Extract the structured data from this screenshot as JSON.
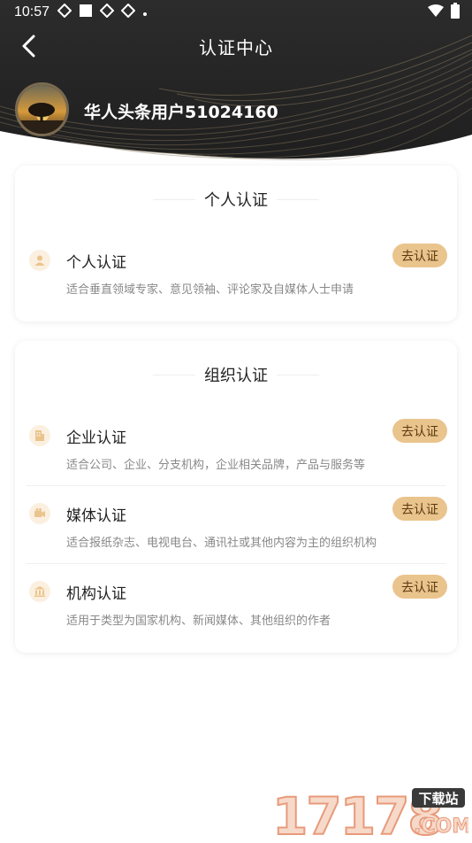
{
  "status_bar": {
    "time": "10:57"
  },
  "nav": {
    "title": "认证中心"
  },
  "user": {
    "name": "华人头条用户51024160"
  },
  "personal": {
    "section_title": "个人认证",
    "items": [
      {
        "icon": "person-icon",
        "title": "个人认证",
        "desc": "适合垂直领域专家、意见领袖、评论家及自媒体人士申请",
        "button": "去认证"
      }
    ]
  },
  "organization": {
    "section_title": "组织认证",
    "items": [
      {
        "icon": "building-icon",
        "title": "企业认证",
        "desc": "适合公司、企业、分支机构，企业相关品牌，产品与服务等",
        "button": "去认证"
      },
      {
        "icon": "camera-icon",
        "title": "媒体认证",
        "desc": "适合报纸杂志、电视电台、通讯社或其他内容为主的组织机构",
        "button": "去认证"
      },
      {
        "icon": "institution-icon",
        "title": "机构认证",
        "desc": "适用于类型为国家机构、新闻媒体、其他组织的作者",
        "button": "去认证"
      }
    ]
  },
  "watermark": {
    "text": "17178",
    "badge": "下载站",
    "domain": ".COM"
  },
  "colors": {
    "header_dark": "#2a2a2a",
    "button_bg": "#eac48d",
    "icon_bg": "#fbefe0"
  }
}
